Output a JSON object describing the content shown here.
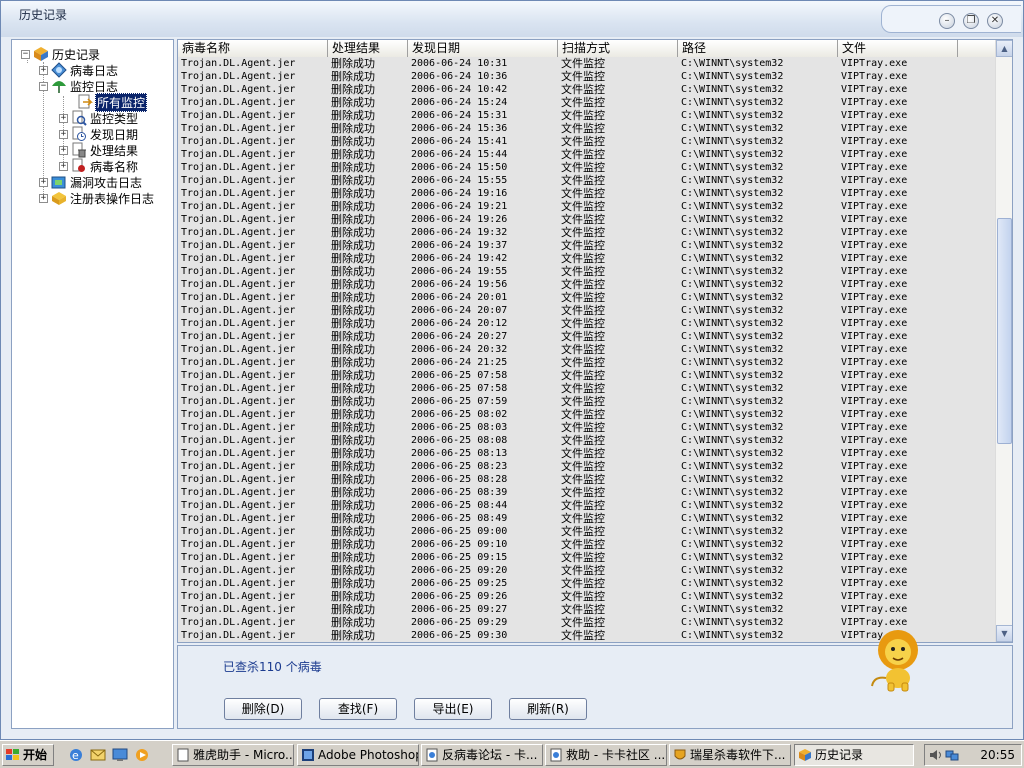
{
  "window": {
    "title": "历史记录"
  },
  "tree": {
    "root": "历史记录",
    "items": [
      {
        "label": "病毒日志"
      },
      {
        "label": "监控日志"
      },
      {
        "label": "所有监控"
      },
      {
        "label": "监控类型"
      },
      {
        "label": "发现日期"
      },
      {
        "label": "处理结果"
      },
      {
        "label": "病毒名称"
      },
      {
        "label": "漏洞攻击日志"
      },
      {
        "label": "注册表操作日志"
      }
    ]
  },
  "list": {
    "columns": [
      "病毒名称",
      "处理结果",
      "发现日期",
      "扫描方式",
      "路径",
      "文件"
    ],
    "virus": "Trojan.DL.Agent.jer",
    "result": "删除成功",
    "scan": "文件监控",
    "path": "C:\\WINNT\\system32",
    "file": "VIPTray.exe",
    "dates": [
      "2006-06-24 10:31",
      "2006-06-24 10:36",
      "2006-06-24 10:42",
      "2006-06-24 15:24",
      "2006-06-24 15:31",
      "2006-06-24 15:36",
      "2006-06-24 15:41",
      "2006-06-24 15:44",
      "2006-06-24 15:50",
      "2006-06-24 15:55",
      "2006-06-24 19:16",
      "2006-06-24 19:21",
      "2006-06-24 19:26",
      "2006-06-24 19:32",
      "2006-06-24 19:37",
      "2006-06-24 19:42",
      "2006-06-24 19:55",
      "2006-06-24 19:56",
      "2006-06-24 20:01",
      "2006-06-24 20:07",
      "2006-06-24 20:12",
      "2006-06-24 20:27",
      "2006-06-24 20:32",
      "2006-06-24 21:25",
      "2006-06-25 07:58",
      "2006-06-25 07:58",
      "2006-06-25 07:59",
      "2006-06-25 08:02",
      "2006-06-25 08:03",
      "2006-06-25 08:08",
      "2006-06-25 08:13",
      "2006-06-25 08:23",
      "2006-06-25 08:28",
      "2006-06-25 08:39",
      "2006-06-25 08:44",
      "2006-06-25 08:49",
      "2006-06-25 09:00",
      "2006-06-25 09:10",
      "2006-06-25 09:15",
      "2006-06-25 09:20",
      "2006-06-25 09:25",
      "2006-06-25 09:26",
      "2006-06-25 09:27",
      "2006-06-25 09:29",
      "2006-06-25 09:30"
    ]
  },
  "status": {
    "text": "已查杀110 个病毒"
  },
  "buttons": {
    "delete": "删除(D)",
    "find": "查找(F)",
    "export": "导出(E)",
    "refresh": "刷新(R)"
  },
  "taskbar": {
    "start": "开始",
    "tasks": [
      {
        "label": "雅虎助手 - Micro..."
      },
      {
        "label": "Adobe Photoshop..."
      },
      {
        "label": "反病毒论坛 - 卡..."
      },
      {
        "label": "救助 - 卡卡社区 ..."
      },
      {
        "label": "瑞星杀毒软件下..."
      },
      {
        "label": "历史记录"
      }
    ],
    "clock": "20:55"
  }
}
